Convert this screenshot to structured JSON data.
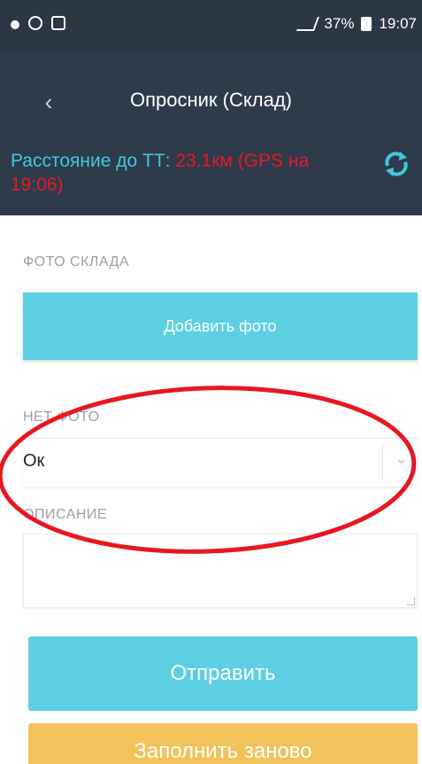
{
  "status_bar": {
    "time": "19:07",
    "battery": "37%",
    "network": "4G"
  },
  "header": {
    "title": "Опросник (Склад)",
    "back_icon": "chevron-left-icon",
    "distance_label": "Расстояние до ТТ: ",
    "distance_value": "23.1км (GPS на 19:06)",
    "refresh_icon": "refresh-icon"
  },
  "form": {
    "photo_section_label": "ФОТО СКЛАДА",
    "add_photo_label": "Добавить фото",
    "no_photo_label": "НЕТ ФОТО",
    "no_photo_value": "Ок",
    "description_label": "ОПИСАНИЕ",
    "description_value": ""
  },
  "actions": {
    "send_label": "Отправить",
    "refill_label": "Заполнить заново"
  },
  "colors": {
    "header_bg": "#2e3b4a",
    "accent_cyan": "#5dcfe2",
    "distance_text": "#3fc9dd",
    "distance_value": "#e8172a",
    "refill_button": "#f2c25a",
    "annotation_ellipse": "#e8171f"
  }
}
